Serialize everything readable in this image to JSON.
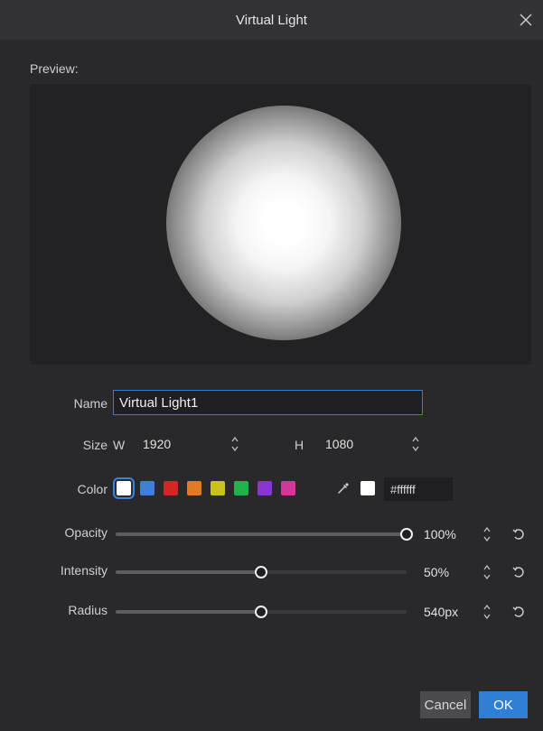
{
  "window": {
    "title": "Virtual Light"
  },
  "preview": {
    "label": "Preview:"
  },
  "name": {
    "label": "Name",
    "value": "Virtual Light1"
  },
  "size": {
    "label": "Size",
    "w_label": "W",
    "w_value": "1920",
    "h_label": "H",
    "h_value": "1080"
  },
  "color": {
    "label": "Color",
    "swatches": [
      "#ffffff",
      "#3d7fd9",
      "#d42424",
      "#e07b22",
      "#c9c21d",
      "#21b24b",
      "#8a35d6",
      "#d6359c"
    ],
    "selected": "#ffffff",
    "current_hex": "#ffffff",
    "eyedropper_icon": "eyedropper-icon"
  },
  "sliders": [
    {
      "label": "Opacity",
      "value": "100%",
      "level": 1.0
    },
    {
      "label": "Intensity",
      "value": "50%",
      "level": 0.5
    },
    {
      "label": "Radius",
      "value": "540px",
      "level": 0.5
    }
  ],
  "buttons": {
    "cancel": "Cancel",
    "ok": "OK"
  },
  "accent": "#2f7fd6"
}
